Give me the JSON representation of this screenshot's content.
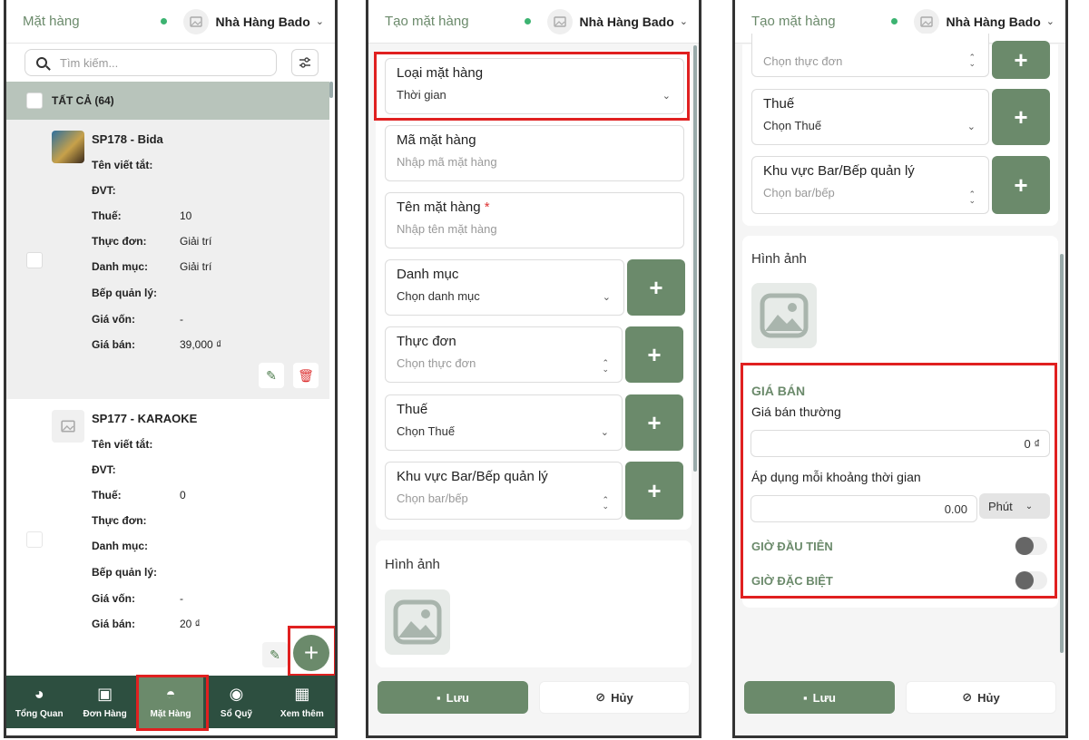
{
  "header": {
    "store_name": "Nhà Hàng Bado"
  },
  "panel1": {
    "title": "Mặt hàng",
    "search_placeholder": "Tìm kiếm...",
    "all_label": "TẤT CẢ (64)",
    "field_labels": {
      "short_name": "Tên viết tắt:",
      "unit": "ĐVT:",
      "tax": "Thuế:",
      "menu": "Thực đơn:",
      "category": "Danh mục:",
      "kitchen": "Bếp quản lý:",
      "cost": "Giá vốn:",
      "price": "Giá bán:"
    },
    "items": [
      {
        "code": "SP178 - Bida",
        "tax": "10",
        "menu": "Giải trí",
        "category": "Giải trí",
        "cost": "-",
        "price": "39,000 ₫"
      },
      {
        "code": "SP177 - KARAOKE",
        "tax": "0",
        "menu": "",
        "category": "",
        "cost": "-",
        "price": "20 ₫"
      }
    ],
    "nav": [
      {
        "label": "Tổng Quan",
        "icon": "pie-chart-icon"
      },
      {
        "label": "Đơn Hàng",
        "icon": "money-icon"
      },
      {
        "label": "Mặt Hàng",
        "icon": "cloche-icon"
      },
      {
        "label": "Sổ Quỹ",
        "icon": "coin-icon"
      },
      {
        "label": "Xem thêm",
        "icon": "grid-icon"
      }
    ]
  },
  "form": {
    "title": "Tạo mặt hàng",
    "type_label": "Loại mặt hàng",
    "type_value": "Thời gian",
    "code_label": "Mã mặt hàng",
    "code_placeholder": "Nhập mã mặt hàng",
    "name_label": "Tên mặt hàng",
    "name_required": "*",
    "name_placeholder": "Nhập tên mặt hàng",
    "category_label": "Danh mục",
    "category_placeholder": "Chọn danh mục",
    "menu_label": "Thực đơn",
    "menu_placeholder": "Chọn thực đơn",
    "tax_label": "Thuế",
    "tax_placeholder": "Chọn Thuế",
    "kitchen_label": "Khu vực Bar/Bếp quản lý",
    "kitchen_placeholder": "Chọn bar/bếp",
    "image_label": "Hình ảnh",
    "plus": "+",
    "save_label": "Lưu",
    "cancel_label": "Hủy"
  },
  "pricing": {
    "section_title": "GIÁ BÁN",
    "regular_label": "Giá bán thường",
    "regular_value": "0 ₫",
    "interval_label": "Áp dụng mỗi khoảng thời gian",
    "interval_value": "0.00",
    "interval_unit": "Phút",
    "first_hour_label": "GIỜ ĐẦU TIÊN",
    "special_hour_label": "GIỜ ĐẶC BIỆT"
  },
  "colors": {
    "accent": "#6b8a6b",
    "nav_bg": "#2d4f40",
    "highlight": "#e02020"
  }
}
